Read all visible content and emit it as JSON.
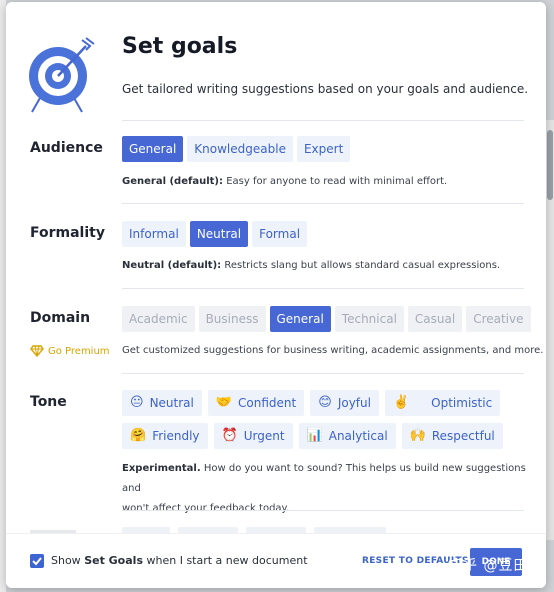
{
  "header": {
    "title": "Set goals",
    "subtitle": "Get tailored writing suggestions based on your goals and audience."
  },
  "audience": {
    "label": "Audience",
    "options": [
      "General",
      "Knowledgeable",
      "Expert"
    ],
    "selected": "General",
    "desc_bold": "General (default):",
    "desc": "Easy for anyone to read with minimal effort."
  },
  "formality": {
    "label": "Formality",
    "options": [
      "Informal",
      "Neutral",
      "Formal"
    ],
    "selected": "Neutral",
    "desc_bold": "Neutral (default):",
    "desc": "Restricts slang but allows standard casual expressions."
  },
  "domain": {
    "label": "Domain",
    "premium": "Go Premium",
    "options": [
      "Academic",
      "Business",
      "General",
      "Technical",
      "Casual",
      "Creative"
    ],
    "selected": "General",
    "desc": "Get customized suggestions for business writing, academic assignments, and more."
  },
  "tone": {
    "label": "Tone",
    "options": [
      {
        "emoji": "😐",
        "label": "Neutral"
      },
      {
        "emoji": "🤝",
        "label": "Confident"
      },
      {
        "emoji": "😊",
        "label": "Joyful"
      },
      {
        "emoji": "✌️",
        "label": "Optimistic"
      },
      {
        "emoji": "🤗",
        "label": "Friendly"
      },
      {
        "emoji": "⏰",
        "label": "Urgent"
      },
      {
        "emoji": "📊",
        "label": "Analytical"
      },
      {
        "emoji": "🙌",
        "label": "Respectful"
      }
    ],
    "desc_bold": "Experimental.",
    "desc_line1": "How do you want to sound? This helps us build new suggestions and",
    "desc_line2": "won't affect your feedback today."
  },
  "footer": {
    "checkbox_checked": true,
    "text_prefix": "Show",
    "text_bold": "Set Goals",
    "text_suffix": "when I start a new document",
    "reset": "RESET TO DEFAULTS",
    "done": "DONE"
  },
  "watermark": "知乎 @豆田",
  "colors": {
    "accent": "#4667d4",
    "option_bg": "#eef2fa",
    "premium": "#d9a400"
  }
}
